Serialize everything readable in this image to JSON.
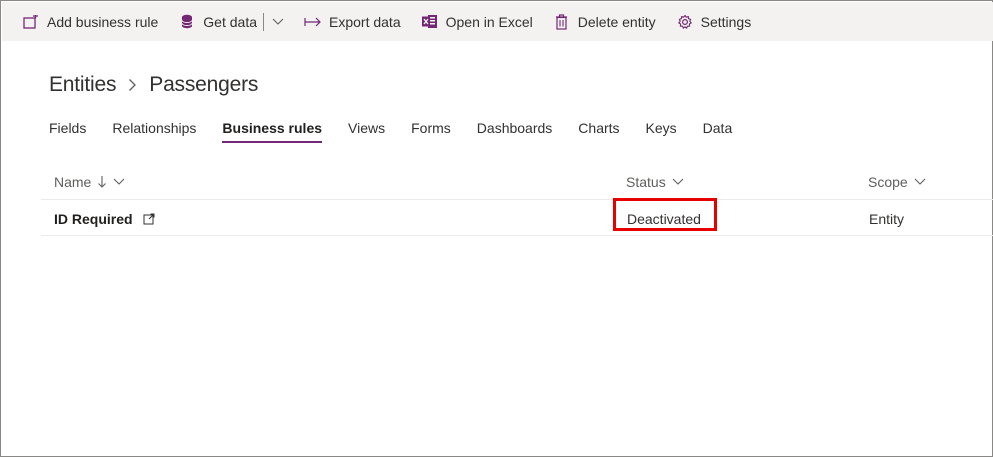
{
  "toolbar": {
    "add_business_rule": "Add business rule",
    "get_data": "Get data",
    "export_data": "Export data",
    "open_in_excel": "Open in Excel",
    "delete_entity": "Delete entity",
    "settings": "Settings"
  },
  "breadcrumb": {
    "parent": "Entities",
    "separator_icon": "chevron-right-icon",
    "current": "Passengers"
  },
  "tabs": [
    {
      "label": "Fields"
    },
    {
      "label": "Relationships"
    },
    {
      "label": "Business rules",
      "active": true
    },
    {
      "label": "Views"
    },
    {
      "label": "Forms"
    },
    {
      "label": "Dashboards"
    },
    {
      "label": "Charts"
    },
    {
      "label": "Keys"
    },
    {
      "label": "Data"
    }
  ],
  "table": {
    "columns": [
      {
        "label": "Name",
        "icons": [
          "sort-down-arrow-icon",
          "chevron-down-icon"
        ]
      },
      {
        "label": "Status",
        "icons": [
          "chevron-down-icon"
        ]
      },
      {
        "label": "Scope",
        "icons": [
          "chevron-down-icon"
        ]
      }
    ],
    "rows": [
      {
        "name": "ID Required",
        "status": "Deactivated",
        "scope": "Entity"
      }
    ]
  },
  "colors": {
    "accent": "#742774",
    "highlight": "#e60000",
    "toolbar_bg": "#f3f2f1"
  }
}
